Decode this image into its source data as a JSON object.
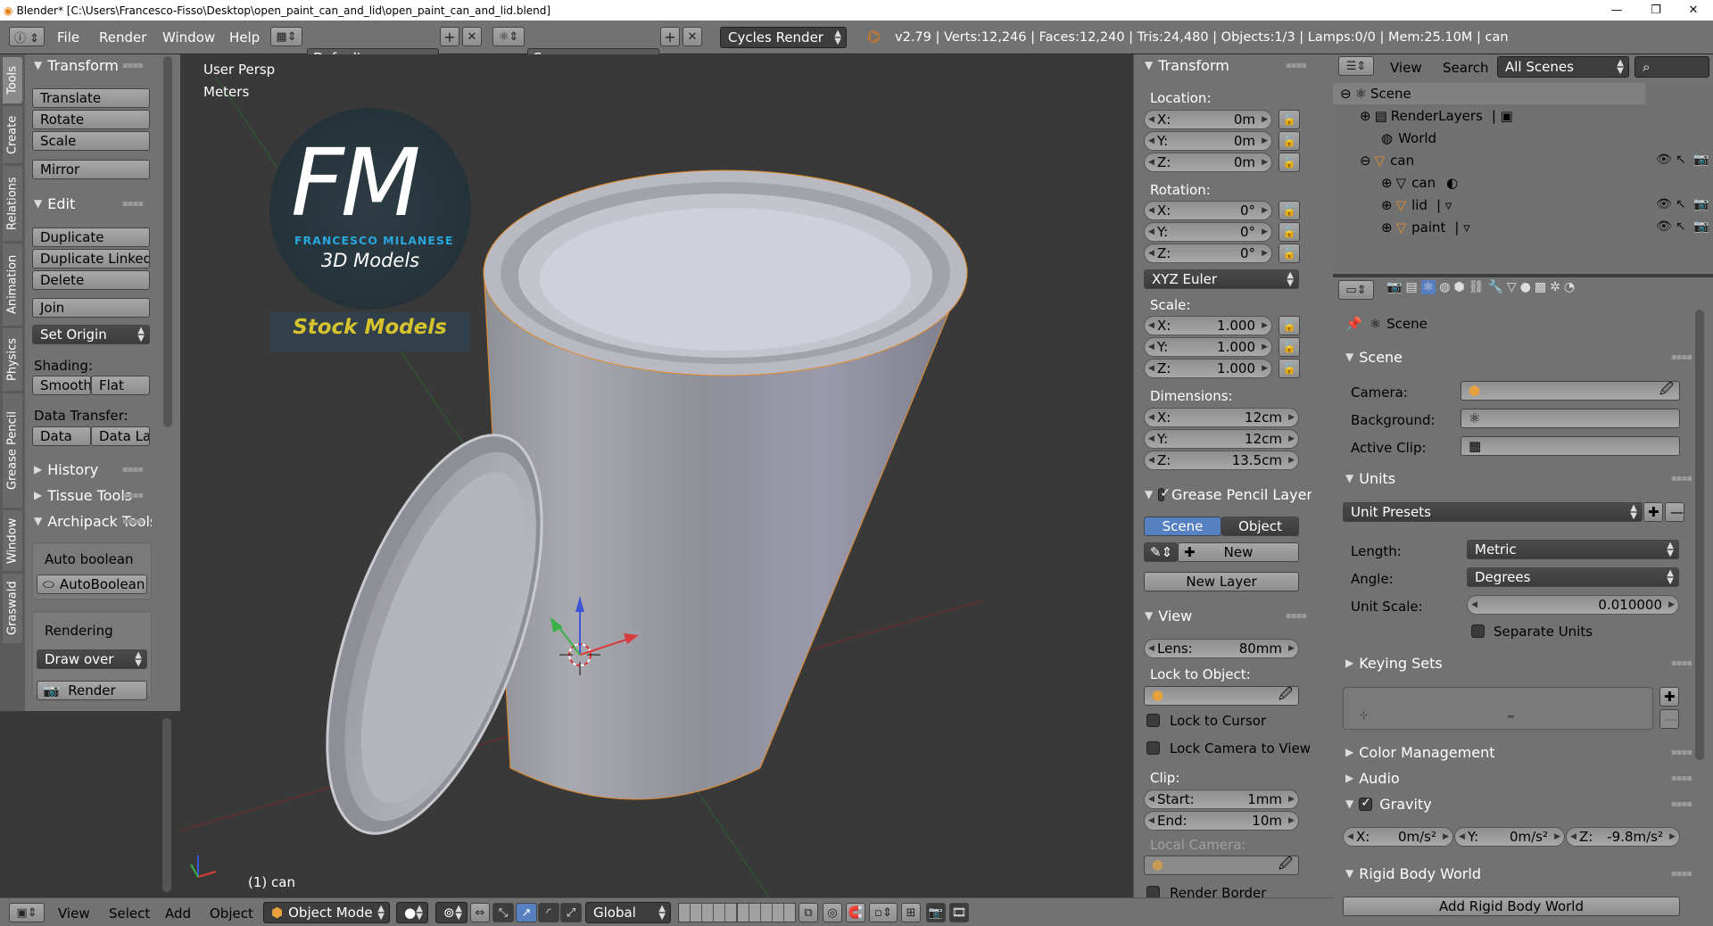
{
  "window": {
    "title": "Blender* [C:\\Users\\Francesco-Fisso\\Desktop\\open_paint_can_and_lid\\open_paint_can_and_lid.blend]"
  },
  "infobar": {
    "menus": [
      "File",
      "Render",
      "Window",
      "Help"
    ],
    "screen_layout": "Default",
    "scene": "Scene",
    "engine": "Cycles Render",
    "stats": "v2.79 | Verts:12,246 | Faces:12,240 | Tris:24,480 | Objects:1/3 | Lamps:0/0 | Mem:25.10M | can"
  },
  "tool_tabs": [
    "Tools",
    "Create",
    "Relations",
    "Animation",
    "Physics",
    "Grease Pencil",
    "Window",
    "Graswald"
  ],
  "tool_shelf": {
    "transform": {
      "title": "Transform",
      "buttons": [
        "Translate",
        "Rotate",
        "Scale",
        "Mirror"
      ]
    },
    "edit": {
      "title": "Edit",
      "buttons": [
        "Duplicate",
        "Duplicate Linked",
        "Delete",
        "Join"
      ],
      "set_origin": "Set Origin",
      "shading_label": "Shading:",
      "smooth": "Smooth",
      "flat": "Flat",
      "data_transfer_label": "Data Transfer:",
      "data": "Data",
      "data_la": "Data La"
    },
    "history": "History",
    "tissue": "Tissue Tools",
    "archipack": {
      "title": "Archipack Tools",
      "auto_boolean_label": "Auto boolean",
      "auto_boolean_btn": "AutoBoolean",
      "rendering_label": "Rendering",
      "draw_over": "Draw over",
      "render": "Render"
    }
  },
  "viewport": {
    "view_name": "User Persp",
    "units": "Meters",
    "object_label": "(1) can",
    "logo": {
      "letters": "FM",
      "name": "FRANCESCO MILANESE",
      "subtitle": "3D Models",
      "stock": "Stock Models"
    }
  },
  "npanel": {
    "transform_title": "Transform",
    "location_label": "Location:",
    "location": [
      {
        "k": "X:",
        "v": "0m"
      },
      {
        "k": "Y:",
        "v": "0m"
      },
      {
        "k": "Z:",
        "v": "0m"
      }
    ],
    "rotation_label": "Rotation:",
    "rotation": [
      {
        "k": "X:",
        "v": "0°"
      },
      {
        "k": "Y:",
        "v": "0°"
      },
      {
        "k": "Z:",
        "v": "0°"
      }
    ],
    "rotation_mode": "XYZ Euler",
    "scale_label": "Scale:",
    "scale": [
      {
        "k": "X:",
        "v": "1.000"
      },
      {
        "k": "Y:",
        "v": "1.000"
      },
      {
        "k": "Z:",
        "v": "1.000"
      }
    ],
    "dimensions_label": "Dimensions:",
    "dimensions": [
      {
        "k": "X:",
        "v": "12cm"
      },
      {
        "k": "Y:",
        "v": "12cm"
      },
      {
        "k": "Z:",
        "v": "13.5cm"
      }
    ],
    "gp_title": "Grease Pencil Layer",
    "gp_scene": "Scene",
    "gp_object": "Object",
    "gp_new": "New",
    "gp_new_layer": "New Layer",
    "view_title": "View",
    "lens": {
      "k": "Lens:",
      "v": "80mm"
    },
    "lock_to_object": "Lock to Object:",
    "lock_to_cursor": "Lock to Cursor",
    "lock_camera": "Lock Camera to View",
    "clip_label": "Clip:",
    "clip_start": {
      "k": "Start:",
      "v": "1mm"
    },
    "clip_end": {
      "k": "End:",
      "v": "10m"
    },
    "local_camera": "Local Camera:",
    "render_border": "Render Border"
  },
  "outliner": {
    "menus": [
      "View",
      "Search"
    ],
    "filter": "All Scenes",
    "items": [
      {
        "name": "Scene",
        "depth": 0
      },
      {
        "name": "RenderLayers",
        "depth": 1
      },
      {
        "name": "World",
        "depth": 1
      },
      {
        "name": "can",
        "depth": 1
      },
      {
        "name": "can",
        "depth": 2
      },
      {
        "name": "lid",
        "depth": 2
      },
      {
        "name": "paint",
        "depth": 2
      }
    ]
  },
  "properties": {
    "breadcrumb": "Scene",
    "scene_title": "Scene",
    "camera_label": "Camera:",
    "background_label": "Background:",
    "active_clip_label": "Active Clip:",
    "units_title": "Units",
    "unit_presets": "Unit Presets",
    "length_label": "Length:",
    "length": "Metric",
    "angle_label": "Angle:",
    "angle": "Degrees",
    "unit_scale_label": "Unit Scale:",
    "unit_scale": "0.010000",
    "separate_units": "Separate Units",
    "keying_sets": "Keying Sets",
    "color_management": "Color Management",
    "audio": "Audio",
    "gravity_title": "Gravity",
    "gravity": [
      {
        "k": "X:",
        "v": "0m/s²"
      },
      {
        "k": "Y:",
        "v": "0m/s²"
      },
      {
        "k": "Z:",
        "v": "-9.8m/s²"
      }
    ],
    "rigid_body_world": "Rigid Body World",
    "add_rigid_body_world": "Add Rigid Body World"
  },
  "bottombar": {
    "menus": [
      "View",
      "Select",
      "Add",
      "Object"
    ],
    "mode": "Object Mode",
    "orientation": "Global"
  }
}
